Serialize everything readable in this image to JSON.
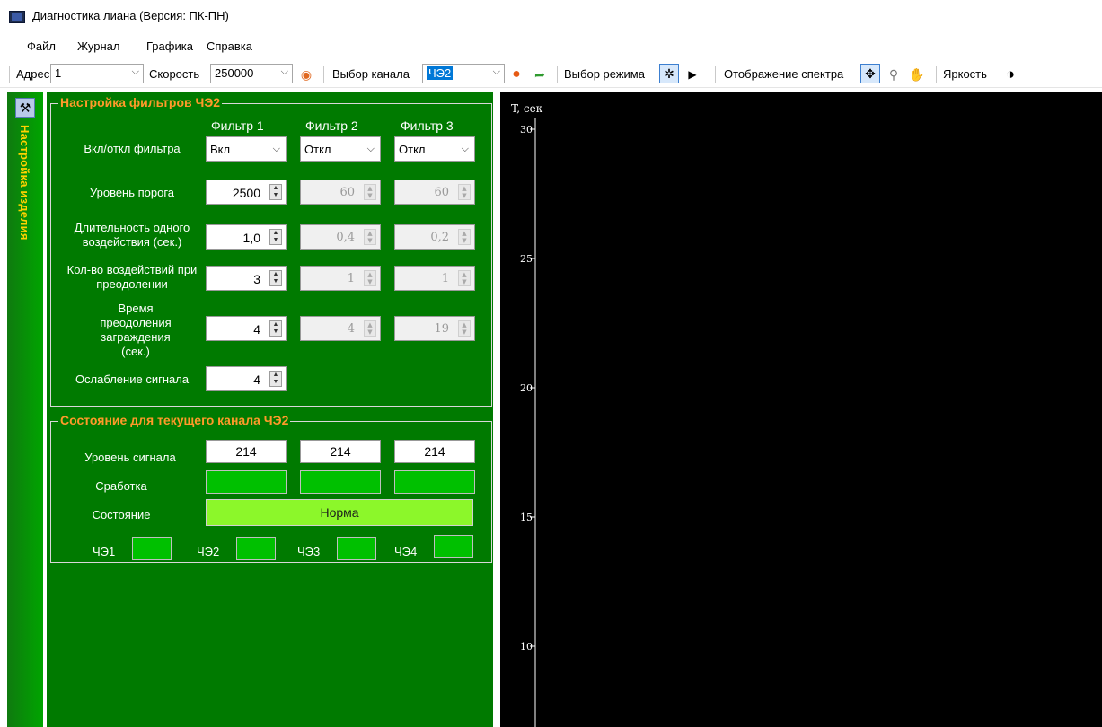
{
  "window": {
    "title": "Диагностика лиана (Версия: ПК-ПН)"
  },
  "menu": [
    "Файл",
    "Журнал",
    "Графика",
    "Справка"
  ],
  "toolbar": {
    "address_label": "Адрес",
    "address_value": "1",
    "speed_label": "Скорость",
    "speed_value": "250000",
    "channel_label": "Выбор канала",
    "channel_value": "ЧЭ2",
    "mode_label": "Выбор режима",
    "spectrum_label": "Отображение спектра",
    "brightness_label": "Яркость"
  },
  "side_tab": {
    "label": "Настройка изделия"
  },
  "filters": {
    "group_title": "Настройка фильтров ЧЭ2",
    "columns": [
      "Фильтр 1",
      "Фильтр 2",
      "Фильтр 3"
    ],
    "rows": [
      {
        "label": "Вкл/откл фильтра",
        "values": [
          "Вкл",
          "Откл",
          "Откл"
        ]
      },
      {
        "label": "Уровень порога",
        "values": [
          "2500",
          "60",
          "60"
        ]
      },
      {
        "label": "Длительность одного воздействия (сек.)",
        "values": [
          "1,0",
          "0,4",
          "0,2"
        ]
      },
      {
        "label": "Кол-во воздействий при преодолении",
        "values": [
          "3",
          "1",
          "1"
        ]
      },
      {
        "label": "Время преодоления заграждения (сек.)",
        "values": [
          "4",
          "4",
          "19"
        ]
      },
      {
        "label": "Ослабление сигнала",
        "values": [
          "4"
        ]
      }
    ]
  },
  "state": {
    "group_title": "Состояние для текущего канала ЧЭ2",
    "signal_label": "Уровень сигнала",
    "signal_values": [
      "214",
      "214",
      "214"
    ],
    "trigger_label": "Сработка",
    "status_label": "Состояние",
    "status_value": "Норма",
    "channels": [
      "ЧЭ1",
      "ЧЭ2",
      "ЧЭ3",
      "ЧЭ4"
    ]
  },
  "chart_data": {
    "type": "line",
    "ylabel": "T, сек",
    "y_ticks": [
      30,
      25,
      20,
      15,
      10
    ],
    "grid": false,
    "series": []
  }
}
